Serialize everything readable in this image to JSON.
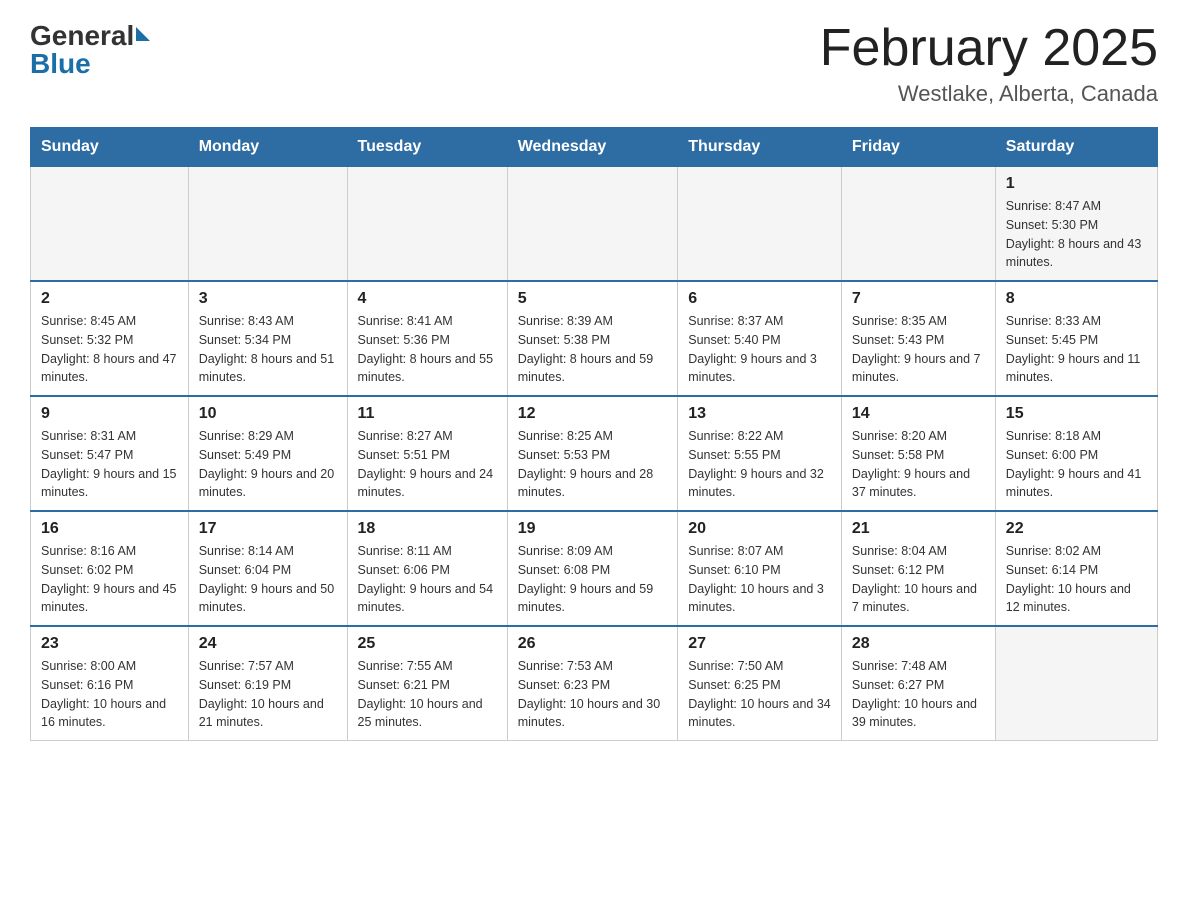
{
  "logo": {
    "text_general": "General",
    "text_blue": "Blue"
  },
  "title": "February 2025",
  "subtitle": "Westlake, Alberta, Canada",
  "weekdays": [
    "Sunday",
    "Monday",
    "Tuesday",
    "Wednesday",
    "Thursday",
    "Friday",
    "Saturday"
  ],
  "weeks": [
    [
      {
        "day": "",
        "info": ""
      },
      {
        "day": "",
        "info": ""
      },
      {
        "day": "",
        "info": ""
      },
      {
        "day": "",
        "info": ""
      },
      {
        "day": "",
        "info": ""
      },
      {
        "day": "",
        "info": ""
      },
      {
        "day": "1",
        "info": "Sunrise: 8:47 AM\nSunset: 5:30 PM\nDaylight: 8 hours and 43 minutes."
      }
    ],
    [
      {
        "day": "2",
        "info": "Sunrise: 8:45 AM\nSunset: 5:32 PM\nDaylight: 8 hours and 47 minutes."
      },
      {
        "day": "3",
        "info": "Sunrise: 8:43 AM\nSunset: 5:34 PM\nDaylight: 8 hours and 51 minutes."
      },
      {
        "day": "4",
        "info": "Sunrise: 8:41 AM\nSunset: 5:36 PM\nDaylight: 8 hours and 55 minutes."
      },
      {
        "day": "5",
        "info": "Sunrise: 8:39 AM\nSunset: 5:38 PM\nDaylight: 8 hours and 59 minutes."
      },
      {
        "day": "6",
        "info": "Sunrise: 8:37 AM\nSunset: 5:40 PM\nDaylight: 9 hours and 3 minutes."
      },
      {
        "day": "7",
        "info": "Sunrise: 8:35 AM\nSunset: 5:43 PM\nDaylight: 9 hours and 7 minutes."
      },
      {
        "day": "8",
        "info": "Sunrise: 8:33 AM\nSunset: 5:45 PM\nDaylight: 9 hours and 11 minutes."
      }
    ],
    [
      {
        "day": "9",
        "info": "Sunrise: 8:31 AM\nSunset: 5:47 PM\nDaylight: 9 hours and 15 minutes."
      },
      {
        "day": "10",
        "info": "Sunrise: 8:29 AM\nSunset: 5:49 PM\nDaylight: 9 hours and 20 minutes."
      },
      {
        "day": "11",
        "info": "Sunrise: 8:27 AM\nSunset: 5:51 PM\nDaylight: 9 hours and 24 minutes."
      },
      {
        "day": "12",
        "info": "Sunrise: 8:25 AM\nSunset: 5:53 PM\nDaylight: 9 hours and 28 minutes."
      },
      {
        "day": "13",
        "info": "Sunrise: 8:22 AM\nSunset: 5:55 PM\nDaylight: 9 hours and 32 minutes."
      },
      {
        "day": "14",
        "info": "Sunrise: 8:20 AM\nSunset: 5:58 PM\nDaylight: 9 hours and 37 minutes."
      },
      {
        "day": "15",
        "info": "Sunrise: 8:18 AM\nSunset: 6:00 PM\nDaylight: 9 hours and 41 minutes."
      }
    ],
    [
      {
        "day": "16",
        "info": "Sunrise: 8:16 AM\nSunset: 6:02 PM\nDaylight: 9 hours and 45 minutes."
      },
      {
        "day": "17",
        "info": "Sunrise: 8:14 AM\nSunset: 6:04 PM\nDaylight: 9 hours and 50 minutes."
      },
      {
        "day": "18",
        "info": "Sunrise: 8:11 AM\nSunset: 6:06 PM\nDaylight: 9 hours and 54 minutes."
      },
      {
        "day": "19",
        "info": "Sunrise: 8:09 AM\nSunset: 6:08 PM\nDaylight: 9 hours and 59 minutes."
      },
      {
        "day": "20",
        "info": "Sunrise: 8:07 AM\nSunset: 6:10 PM\nDaylight: 10 hours and 3 minutes."
      },
      {
        "day": "21",
        "info": "Sunrise: 8:04 AM\nSunset: 6:12 PM\nDaylight: 10 hours and 7 minutes."
      },
      {
        "day": "22",
        "info": "Sunrise: 8:02 AM\nSunset: 6:14 PM\nDaylight: 10 hours and 12 minutes."
      }
    ],
    [
      {
        "day": "23",
        "info": "Sunrise: 8:00 AM\nSunset: 6:16 PM\nDaylight: 10 hours and 16 minutes."
      },
      {
        "day": "24",
        "info": "Sunrise: 7:57 AM\nSunset: 6:19 PM\nDaylight: 10 hours and 21 minutes."
      },
      {
        "day": "25",
        "info": "Sunrise: 7:55 AM\nSunset: 6:21 PM\nDaylight: 10 hours and 25 minutes."
      },
      {
        "day": "26",
        "info": "Sunrise: 7:53 AM\nSunset: 6:23 PM\nDaylight: 10 hours and 30 minutes."
      },
      {
        "day": "27",
        "info": "Sunrise: 7:50 AM\nSunset: 6:25 PM\nDaylight: 10 hours and 34 minutes."
      },
      {
        "day": "28",
        "info": "Sunrise: 7:48 AM\nSunset: 6:27 PM\nDaylight: 10 hours and 39 minutes."
      },
      {
        "day": "",
        "info": ""
      }
    ]
  ]
}
